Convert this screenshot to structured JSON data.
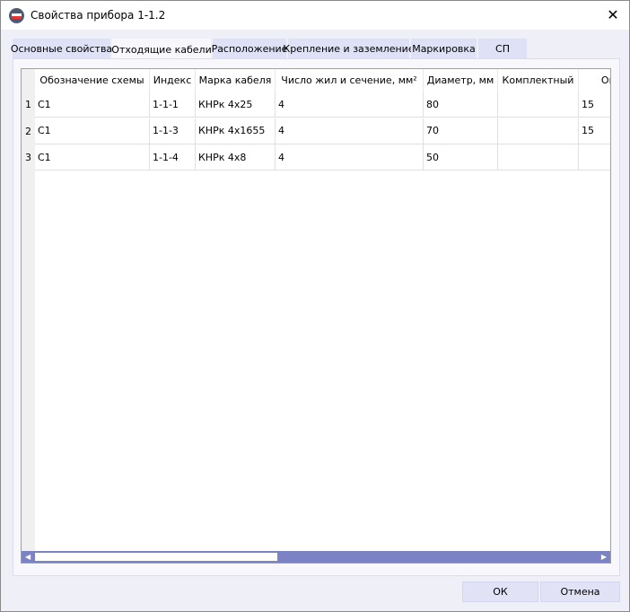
{
  "window": {
    "title": "Свойства прибора 1-1.2"
  },
  "tabs": [
    {
      "label": "Основные свойства",
      "active": false
    },
    {
      "label": "Отходящие кабели",
      "active": true
    },
    {
      "label": "Расположение",
      "active": false
    },
    {
      "label": "Крепление и заземление",
      "active": false
    },
    {
      "label": "Маркировка",
      "active": false
    },
    {
      "label": "СП",
      "active": false
    }
  ],
  "table": {
    "columns": [
      "Обозначение схемы",
      "Индекс",
      "Марка кабеля",
      "Число жил и сечение, мм²",
      "Диаметр, мм",
      "Комплектный",
      "Огра"
    ],
    "rows": [
      {
        "num": "1",
        "cells": [
          "C1",
          "1-1-1",
          "КНРк 4x25",
          "4",
          "80",
          "",
          "15"
        ]
      },
      {
        "num": "2",
        "cells": [
          "C1",
          "1-1-3",
          "КНРк 4x1655",
          "4",
          "70",
          "",
          "15"
        ]
      },
      {
        "num": "3",
        "cells": [
          "C1",
          "1-1-4",
          "КНРк 4x8",
          "4",
          "50",
          "",
          ""
        ]
      }
    ]
  },
  "buttons": {
    "ok": "ОК",
    "cancel": "Отмена"
  },
  "colors": {
    "scrollbar": "#7b83c4",
    "tab": "#dfe1f7",
    "button": "#e1e2f6"
  }
}
